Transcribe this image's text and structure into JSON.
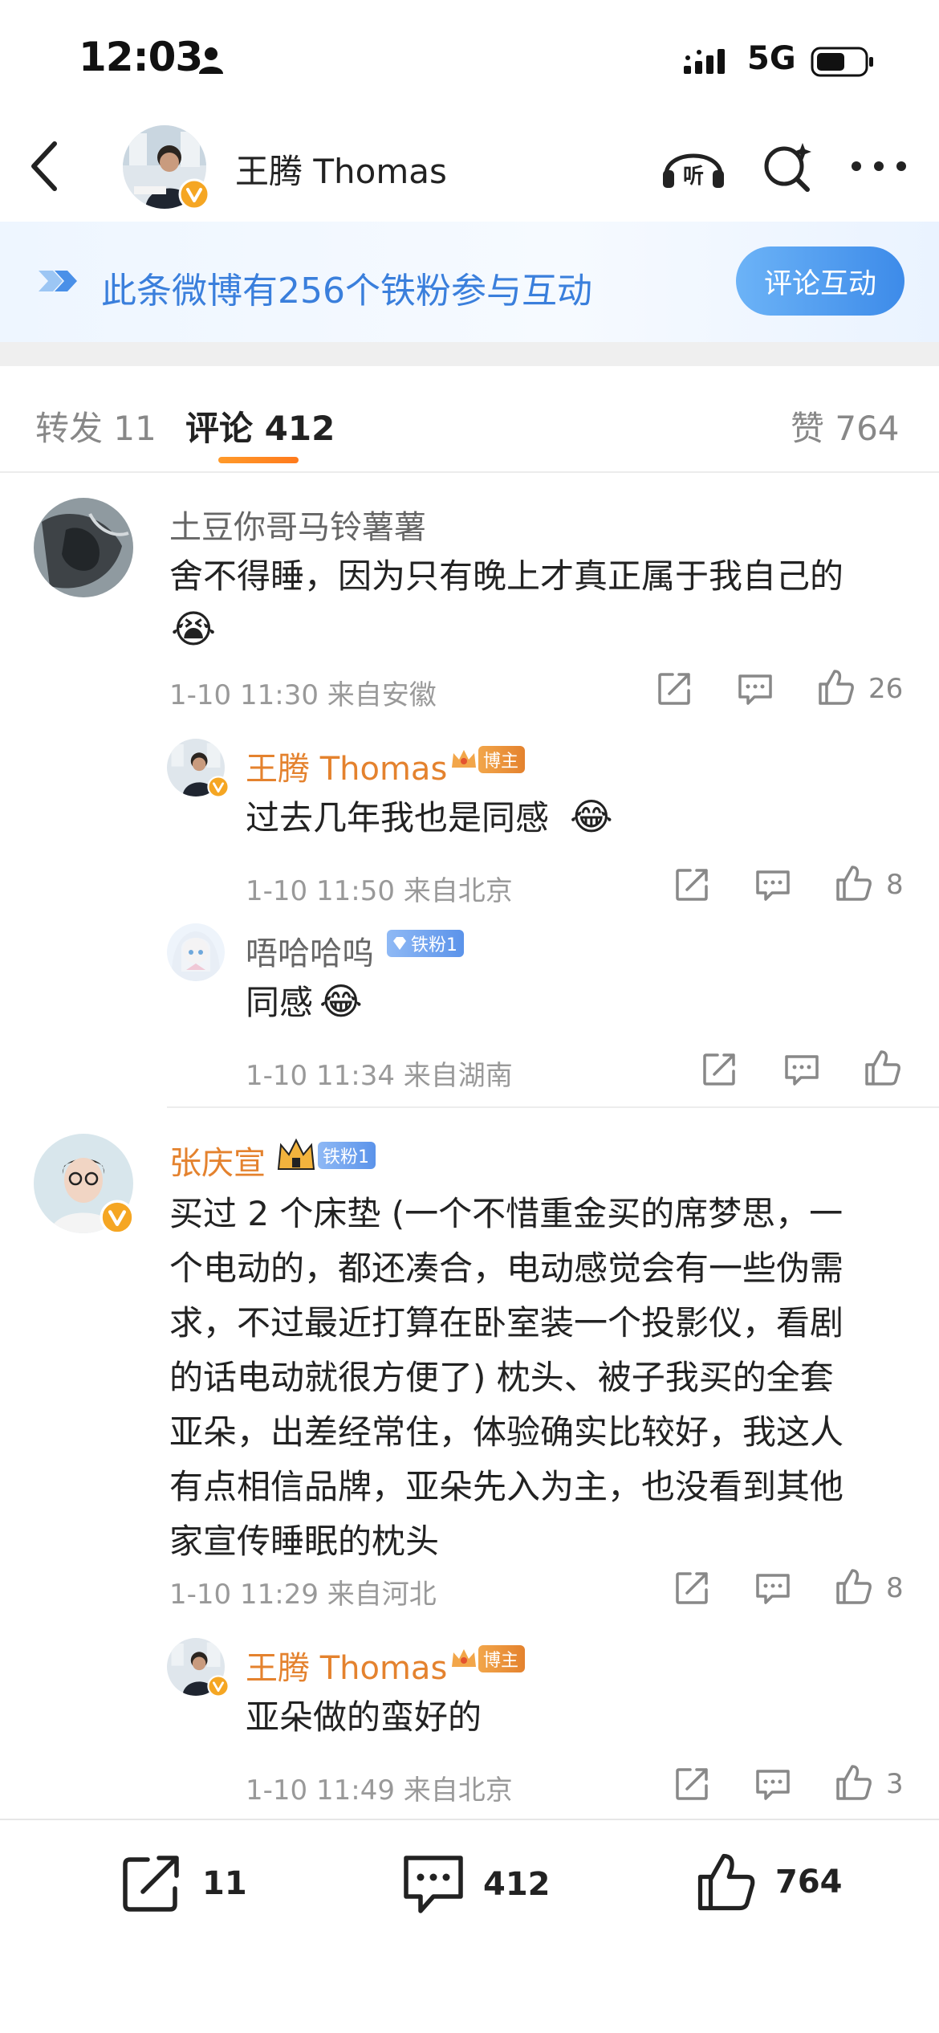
{
  "status_bar": {
    "time": "12:03",
    "network": "5G"
  },
  "header": {
    "title": "王腾 Thomas"
  },
  "fans_banner": {
    "text": "此条微博有256个铁粉参与互动",
    "button": "评论互动"
  },
  "tabs": {
    "repost": "转发 11",
    "comment": "评论 412",
    "like": "赞 764"
  },
  "comments": [
    {
      "user": "土豆你哥马铃薯薯",
      "text": "舍不得睡，因为只有晚上才真正属于我自己的",
      "emoji": "😭",
      "meta": "1-10 11:30  来自安徽",
      "likes": "26",
      "replies": [
        {
          "user": "王腾 Thomas",
          "tag": "博主",
          "text": "过去几年我也是同感",
          "emoji": "😂",
          "meta": "1-10 11:50  来自北京",
          "likes": "8"
        },
        {
          "user": "唔哈哈呜",
          "tag": "铁粉1",
          "text": "同感",
          "emoji": "😂",
          "meta": "1-10 11:34  来自湖南",
          "likes": ""
        }
      ]
    },
    {
      "user": "张庆宣",
      "tag": "铁粉1",
      "text_lines": [
        "买过 2 个床垫 (一个不惜重金买的席梦思，一",
        "个电动的，都还凑合，电动感觉会有一些伪需",
        "求，不过最近打算在卧室装一个投影仪，看剧",
        "的话电动就很方便了) 枕头、被子我买的全套",
        "亚朵，出差经常住，体验确实比较好，我这人",
        "有点相信品牌，亚朵先入为主，也没看到其他",
        "家宣传睡眠的枕头"
      ],
      "meta": "1-10 11:29  来自河北",
      "likes": "8",
      "replies": [
        {
          "user": "王腾 Thomas",
          "tag": "博主",
          "text": "亚朵做的蛮好的",
          "meta": "1-10 11:49  来自北京",
          "likes": "3"
        }
      ]
    }
  ],
  "bottom_bar": {
    "repost_count": "11",
    "comment_count": "412",
    "like_count": "764"
  },
  "icons": [
    "person-icon",
    "signal-icon",
    "battery-icon",
    "back-icon",
    "verified-badge-icon",
    "listen-icon",
    "compose-icon",
    "more-icon",
    "share-icon",
    "comment-icon",
    "like-icon",
    "crown-icon",
    "diamond-icon"
  ],
  "colors": {
    "accent_orange": "#e4822e",
    "accent_blue": "#3a7fdc",
    "fan_tag": "#5b93ea"
  }
}
